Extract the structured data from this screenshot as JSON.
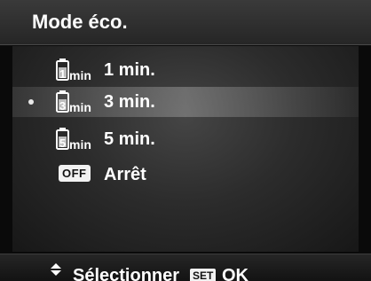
{
  "header": {
    "title": "Mode éco."
  },
  "menu": {
    "items": [
      {
        "icon": "battery-timer-icon",
        "icon_number": "1",
        "icon_unit": "min",
        "label": "1 min.",
        "selected": false
      },
      {
        "icon": "battery-timer-icon",
        "icon_number": "3",
        "icon_unit": "min",
        "label": "3 min.",
        "selected": true
      },
      {
        "icon": "battery-timer-icon",
        "icon_number": "5",
        "icon_unit": "min",
        "label": "5 min.",
        "selected": false
      },
      {
        "icon": "off-icon",
        "icon_text": "OFF",
        "label": "Arrêt",
        "selected": false
      }
    ]
  },
  "footer": {
    "nav_icon": "up-down-arrow-icon",
    "select_label": "Sélectionner",
    "set_badge": "SET",
    "ok_label": "OK"
  },
  "colors": {
    "text": "#ffffff",
    "header_bg": "#2f2f2f",
    "panel_bg": "#2c2c2c",
    "badge_bg": "#f2f2f2"
  }
}
